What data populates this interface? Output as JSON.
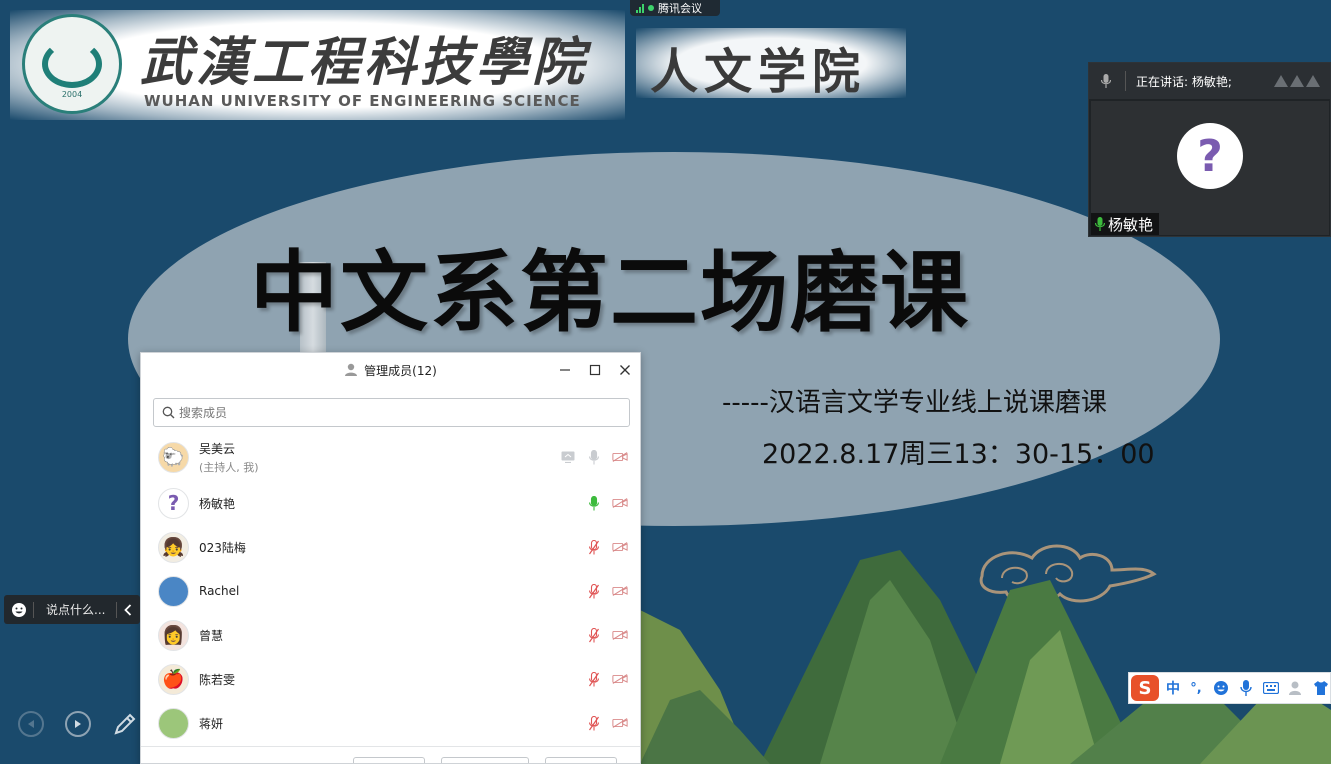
{
  "app": {
    "meeting_name": "腾讯会议"
  },
  "slide": {
    "school_cn": "武漢工程科技學院",
    "school_en": "WUHAN UNIVERSITY OF ENGINEERING SCIENCE",
    "seal_year": "2004",
    "department": "人文学院",
    "title": "中文系第二场磨课",
    "subtitle": "-----汉语言文学专业线上说课磨课",
    "datetime": "2022.8.17周三13：30-15：00"
  },
  "speaker_panel": {
    "speaking_label": "正在讲话: 杨敏艳;",
    "name": "杨敏艳"
  },
  "members_dialog": {
    "title": "管理成员(12)",
    "search_placeholder": "搜索成员",
    "members": [
      {
        "name": "吴美云",
        "role": "(主持人, 我)",
        "avatar": "🐑",
        "avatar_bg": "#f6d9a8",
        "mic": "idle",
        "screen_share": true
      },
      {
        "name": "杨敏艳",
        "role": "",
        "avatar": "?",
        "avatar_bg": "#ffffff",
        "mic": "active",
        "screen_share": false
      },
      {
        "name": "023陆梅",
        "role": "",
        "avatar": "👧",
        "avatar_bg": "#f2ede2",
        "mic": "muted",
        "screen_share": false
      },
      {
        "name": "Rachel",
        "role": "",
        "avatar": "",
        "avatar_bg": "#4a86c5",
        "mic": "muted",
        "screen_share": false
      },
      {
        "name": "曾慧",
        "role": "",
        "avatar": "👩",
        "avatar_bg": "#f3e3de",
        "mic": "muted",
        "screen_share": false
      },
      {
        "name": "陈若雯",
        "role": "",
        "avatar": "🍎",
        "avatar_bg": "#f4ead8",
        "mic": "muted",
        "screen_share": false
      },
      {
        "name": "蒋妍",
        "role": "",
        "avatar": "",
        "avatar_bg": "#9cc67a",
        "mic": "muted",
        "screen_share": false
      }
    ]
  },
  "chat_bar": {
    "placeholder": "说点什么..."
  },
  "ime": {
    "logo": "S",
    "mode": "中",
    "punct": "°,"
  },
  "colors": {
    "slide_bg": "#1a4a6c",
    "ellipse": "#8fa3b1",
    "mic_active": "#3dbb3d",
    "muted_red": "#e05555",
    "ime_blue": "#2173d9",
    "sogou_orange": "#e8512a"
  }
}
